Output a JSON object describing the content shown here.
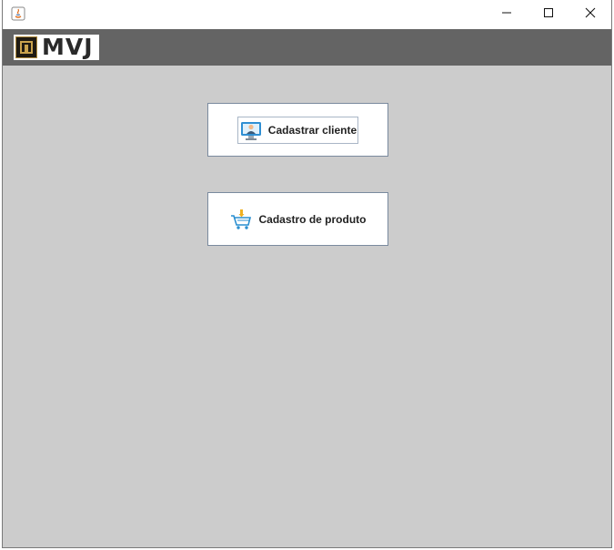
{
  "window": {
    "controls": {
      "minimize_icon": "minimize-icon",
      "maximize_icon": "maximize-icon",
      "close_icon": "close-icon"
    }
  },
  "banner": {
    "logo_text": "MVJ",
    "background_color": "#646464"
  },
  "buttons": {
    "cliente": {
      "label": "Cadastrar cliente",
      "icon": "customer-computer-icon"
    },
    "produto": {
      "label": "Cadastro de produto",
      "icon": "shopping-cart-icon"
    }
  },
  "colors": {
    "window_background": "#cccccc",
    "button_border": "#7a8a9e"
  }
}
